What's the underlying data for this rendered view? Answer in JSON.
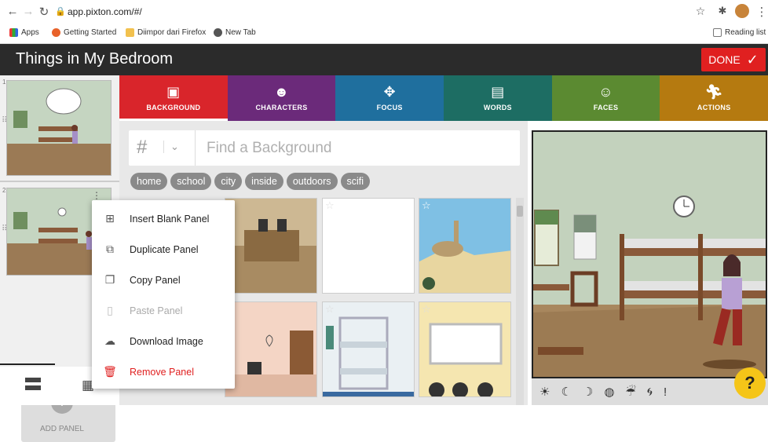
{
  "browser": {
    "url": "app.pixton.com/#/",
    "bookmarks": [
      "Apps",
      "Getting Started",
      "Diimpor dari Firefox",
      "New Tab"
    ],
    "reading_list": "Reading list"
  },
  "header": {
    "title": "Things in My Bedroom",
    "done_label": "DONE"
  },
  "tabs": [
    {
      "label": "BACKGROUND",
      "color": "#d9252b"
    },
    {
      "label": "CHARACTERS",
      "color": "#6b2a7a"
    },
    {
      "label": "FOCUS",
      "color": "#1f6f9e"
    },
    {
      "label": "WORDS",
      "color": "#1d6d63"
    },
    {
      "label": "FACES",
      "color": "#5b8a31"
    },
    {
      "label": "ACTIONS",
      "color": "#b57a10"
    }
  ],
  "sidebar": {
    "panel_numbers": [
      "1",
      "2"
    ],
    "add_panel_label": "ADD PANEL"
  },
  "search": {
    "hash": "#",
    "placeholder": "Find a Background"
  },
  "tags": [
    "home",
    "school",
    "city",
    "inside",
    "outdoors",
    "scifi"
  ],
  "context_menu": [
    {
      "label": "Insert Blank Panel",
      "icon": "plus-square-icon",
      "state": "normal"
    },
    {
      "label": "Duplicate Panel",
      "icon": "duplicate-icon",
      "state": "normal"
    },
    {
      "label": "Copy Panel",
      "icon": "copy-icon",
      "state": "normal"
    },
    {
      "label": "Paste Panel",
      "icon": "clipboard-icon",
      "state": "disabled"
    },
    {
      "label": "Download Image",
      "icon": "cloud-download-icon",
      "state": "normal"
    },
    {
      "label": "Remove Panel",
      "icon": "trash-icon",
      "state": "danger"
    }
  ],
  "help_label": "?"
}
